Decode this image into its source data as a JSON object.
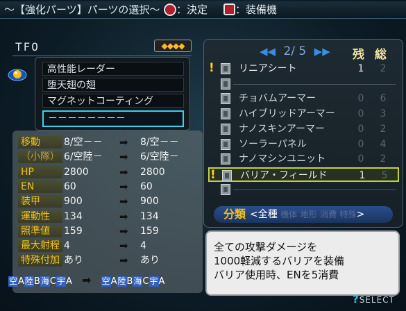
{
  "header": {
    "title": "〜【強化パーツ】パーツの選択〜",
    "confirm_label": "：決定",
    "equip_label": "：装備機"
  },
  "unit": {
    "name": "TFO",
    "rank": "◆◆◆◆"
  },
  "equipped_parts": [
    {
      "label": "高性能レーダー"
    },
    {
      "label": "堕天翅の翅"
    },
    {
      "label": "マグネットコーティング"
    },
    {
      "label": "－－－－－－－－"
    }
  ],
  "stats": [
    {
      "label": "移動",
      "before": "8/空－－",
      "after": "8/空－－"
    },
    {
      "label": "（小隊）",
      "before": "6/空陸－",
      "after": "6/空陸－"
    },
    {
      "label": "HP",
      "before": "2800",
      "after": "2800"
    },
    {
      "label": "EN",
      "before": "60",
      "after": "60"
    },
    {
      "label": "装甲",
      "before": "900",
      "after": "900"
    },
    {
      "label": "運動性",
      "before": "134",
      "after": "134"
    },
    {
      "label": "照準値",
      "before": "159",
      "after": "159"
    },
    {
      "label": "最大射程",
      "before": "4",
      "after": "4"
    },
    {
      "label": "特殊付加",
      "before": "あり",
      "after": "あり"
    }
  ],
  "arrow_glyph": "➡",
  "terrain": {
    "before": [
      {
        "k": "空",
        "v": "A"
      },
      {
        "k": "陸",
        "v": "B"
      },
      {
        "k": "海",
        "v": "C"
      },
      {
        "k": "宇",
        "v": "A"
      }
    ],
    "after": [
      {
        "k": "空",
        "v": "A"
      },
      {
        "k": "陸",
        "v": "B"
      },
      {
        "k": "海",
        "v": "C"
      },
      {
        "k": "宇",
        "v": "A"
      }
    ]
  },
  "list": {
    "page": "2/ 5",
    "col_remaining": "残",
    "col_total": "総",
    "items": [
      {
        "name": "リニアシート",
        "remaining": "1",
        "total": "2",
        "flag": "!",
        "dim": false,
        "highlight": false
      },
      {
        "name": "",
        "remaining": "",
        "total": "",
        "flag": "",
        "dim": false,
        "highlight": false
      },
      {
        "name": "チョバムアーマー",
        "remaining": "0",
        "total": "6",
        "flag": "",
        "dim": true,
        "highlight": false
      },
      {
        "name": "ハイブリッドアーマー",
        "remaining": "0",
        "total": "3",
        "flag": "",
        "dim": true,
        "highlight": false
      },
      {
        "name": "ナノスキンアーマー",
        "remaining": "0",
        "total": "2",
        "flag": "",
        "dim": true,
        "highlight": false
      },
      {
        "name": "ソーラーパネル",
        "remaining": "0",
        "total": "4",
        "flag": "",
        "dim": true,
        "highlight": false
      },
      {
        "name": "ナノマシンユニット",
        "remaining": "0",
        "total": "2",
        "flag": "",
        "dim": true,
        "highlight": false
      },
      {
        "name": "バリア・フィールド",
        "remaining": "1",
        "total": "5",
        "flag": "!",
        "dim": false,
        "highlight": true
      },
      {
        "name": "",
        "remaining": "",
        "total": "",
        "flag": "",
        "dim": false,
        "highlight": false
      }
    ]
  },
  "category": {
    "label": "分類",
    "left_arrow": "<",
    "selected": "全種",
    "others": [
      "機体",
      "地形",
      "消費",
      "特殊"
    ],
    "right_arrow": ">"
  },
  "description": [
    "全ての攻撃ダメージを",
    "1000軽減するバリアを装備",
    "バリア使用時、ENを5消費"
  ],
  "footer": {
    "select_label": "SELECT",
    "select_glyph": "?"
  },
  "colors": {
    "accent": "#3dd0e8",
    "highlight": "#c0d23a",
    "label_gold": "#f0c020",
    "button_red": "#b21e2e"
  }
}
